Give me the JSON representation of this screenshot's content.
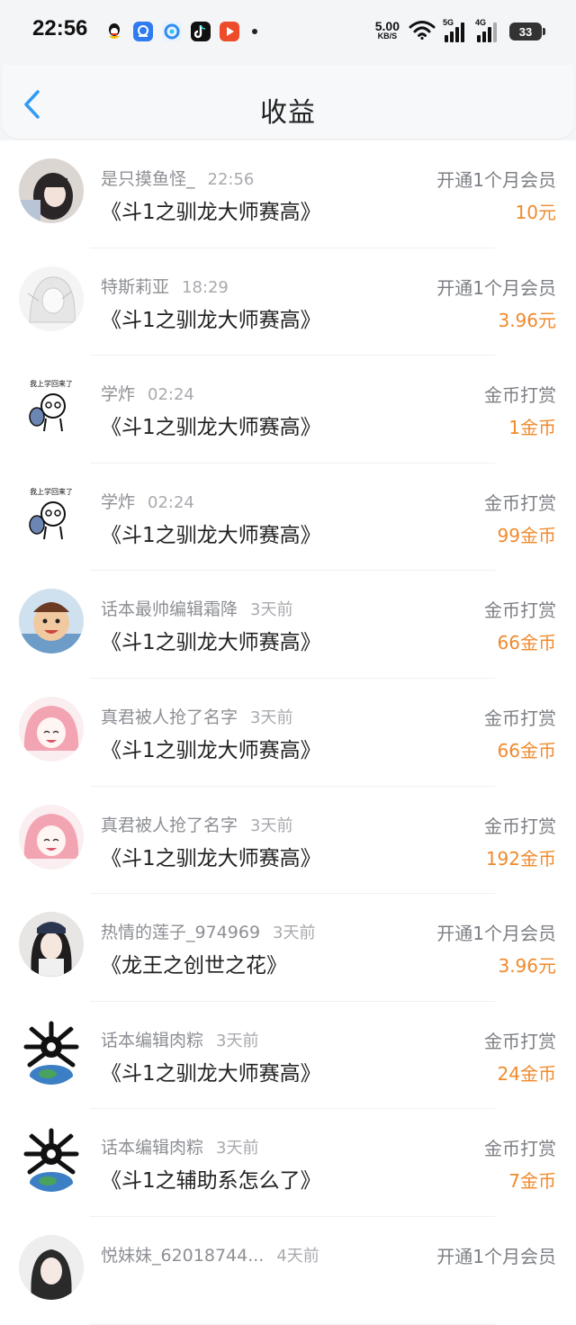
{
  "status_bar": {
    "time": "22:56",
    "net_speed_value": "5.00",
    "net_speed_unit": "KB/S",
    "signal1_label": "5G",
    "signal2_label": "4G",
    "battery": "33",
    "icons": [
      "qq-icon",
      "baidu-netdisk-icon",
      "browser-icon",
      "douyin-icon",
      "video-icon"
    ]
  },
  "header": {
    "title": "收益",
    "back_icon": "chevron-left-icon"
  },
  "colors": {
    "accent": "#2f9bf5",
    "amount": "#f08a2c"
  },
  "rows": [
    {
      "user": "是只摸鱼怪_",
      "time": "22:56",
      "book": "《斗1之驯龙大师赛高》",
      "type": "开通1个月会员",
      "amount": "10元"
    },
    {
      "user": "特斯莉亚",
      "time": "18:29",
      "book": "《斗1之驯龙大师赛高》",
      "type": "开通1个月会员",
      "amount": "3.96元"
    },
    {
      "user": "学炸",
      "time": "02:24",
      "book": "《斗1之驯龙大师赛高》",
      "type": "金币打赏",
      "amount": "1金币"
    },
    {
      "user": "学炸",
      "time": "02:24",
      "book": "《斗1之驯龙大师赛高》",
      "type": "金币打赏",
      "amount": "99金币"
    },
    {
      "user": "话本最帅编辑霜降",
      "time": "3天前",
      "book": "《斗1之驯龙大师赛高》",
      "type": "金币打赏",
      "amount": "66金币"
    },
    {
      "user": "真君被人抢了名字",
      "time": "3天前",
      "book": "《斗1之驯龙大师赛高》",
      "type": "金币打赏",
      "amount": "66金币"
    },
    {
      "user": "真君被人抢了名字",
      "time": "3天前",
      "book": "《斗1之驯龙大师赛高》",
      "type": "金币打赏",
      "amount": "192金币"
    },
    {
      "user": "热情的莲子_974969",
      "time": "3天前",
      "book": "《龙王之创世之花》",
      "type": "开通1个月会员",
      "amount": "3.96元"
    },
    {
      "user": "话本编辑肉粽",
      "time": "3天前",
      "book": "《斗1之驯龙大师赛高》",
      "type": "金币打赏",
      "amount": "24金币"
    },
    {
      "user": "话本编辑肉粽",
      "time": "3天前",
      "book": "《斗1之辅助系怎么了》",
      "type": "金币打赏",
      "amount": "7金币"
    },
    {
      "user": "悦妹妹_62018744...",
      "time": "4天前",
      "book": "",
      "type": "开通1个月会员",
      "amount": ""
    }
  ]
}
